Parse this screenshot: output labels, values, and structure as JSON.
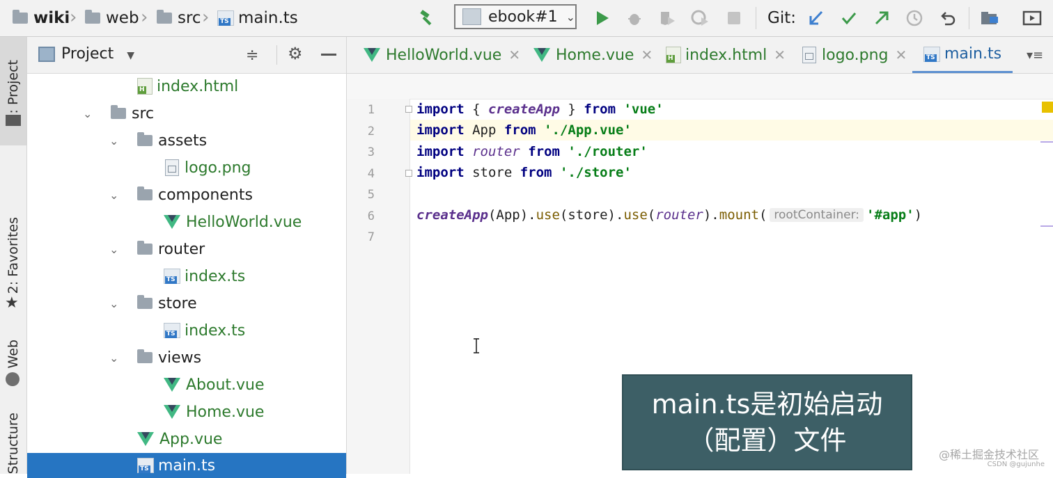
{
  "toolbar": {
    "breadcrumbs": [
      "wiki",
      "web",
      "src",
      "main.ts"
    ],
    "run_config": "ebook#1",
    "git_label": "Git:"
  },
  "left_strip": {
    "project_tab": "1: Project",
    "favorites_tab": "2: Favorites",
    "web_tab": "Web",
    "structure_tab": "Structure"
  },
  "project_panel": {
    "title": "Project",
    "tree": [
      {
        "label": "index.html",
        "type": "html"
      },
      {
        "label": "src",
        "type": "folder"
      },
      {
        "label": "assets",
        "type": "folder"
      },
      {
        "label": "logo.png",
        "type": "png"
      },
      {
        "label": "components",
        "type": "folder"
      },
      {
        "label": "HelloWorld.vue",
        "type": "vue"
      },
      {
        "label": "router",
        "type": "folder"
      },
      {
        "label": "index.ts",
        "type": "ts"
      },
      {
        "label": "store",
        "type": "folder"
      },
      {
        "label": "index.ts",
        "type": "ts"
      },
      {
        "label": "views",
        "type": "folder"
      },
      {
        "label": "About.vue",
        "type": "vue"
      },
      {
        "label": "Home.vue",
        "type": "vue"
      },
      {
        "label": "App.vue",
        "type": "vue"
      },
      {
        "label": "main.ts",
        "type": "ts"
      }
    ]
  },
  "editor": {
    "tabs": [
      "HelloWorld.vue",
      "Home.vue",
      "index.html",
      "logo.png",
      "main.ts"
    ],
    "active_tab": "main.ts",
    "line_numbers": [
      "1",
      "2",
      "3",
      "4",
      "5",
      "6",
      "7"
    ],
    "code": {
      "l1": {
        "kw1": "import",
        "p1": " { ",
        "fn": "createApp",
        "p2": " } ",
        "kw2": "from",
        "sp": " ",
        "str": "'vue'"
      },
      "l2": {
        "kw1": "import",
        "p1": " App ",
        "kw2": "from",
        "sp": " ",
        "str": "'./App.vue'"
      },
      "l3": {
        "kw1": "import",
        "sp1": " ",
        "id": "router",
        "sp2": " ",
        "kw2": "from",
        "sp3": " ",
        "str": "'./router'"
      },
      "l4": {
        "kw1": "import",
        "p1": " store ",
        "kw2": "from",
        "sp": " ",
        "str": "'./store'"
      },
      "l6": {
        "fn": "createApp",
        "p1": "(App).",
        "m1": "use",
        "p2": "(store).",
        "m2": "use",
        "p3": "(",
        "id": "router",
        "p4": ").",
        "m3": "mount",
        "p5": "(",
        "hint": "rootContainer:",
        "str": "'#app'",
        "p6": ")"
      }
    }
  },
  "overlay": {
    "line1": "main.ts是初始启动",
    "line2": "（配置）文件"
  },
  "watermark": {
    "text": "@稀土掘金技术社区",
    "sub": "CSDN @gujunhe"
  },
  "icons": {
    "build": "hammer-icon",
    "run": "play-icon",
    "debug": "bug-icon",
    "coverage": "coverage-icon",
    "profile": "profile-icon",
    "stop": "stop-icon",
    "git_update": "git-update-icon",
    "git_commit": "git-commit-icon",
    "git_push": "git-push-icon",
    "history": "history-icon",
    "rollback": "rollback-icon"
  },
  "colors": {
    "selection": "#2675c2",
    "vcs_green": "#2d7a2d",
    "overlay_bg": "#3d5f66"
  }
}
